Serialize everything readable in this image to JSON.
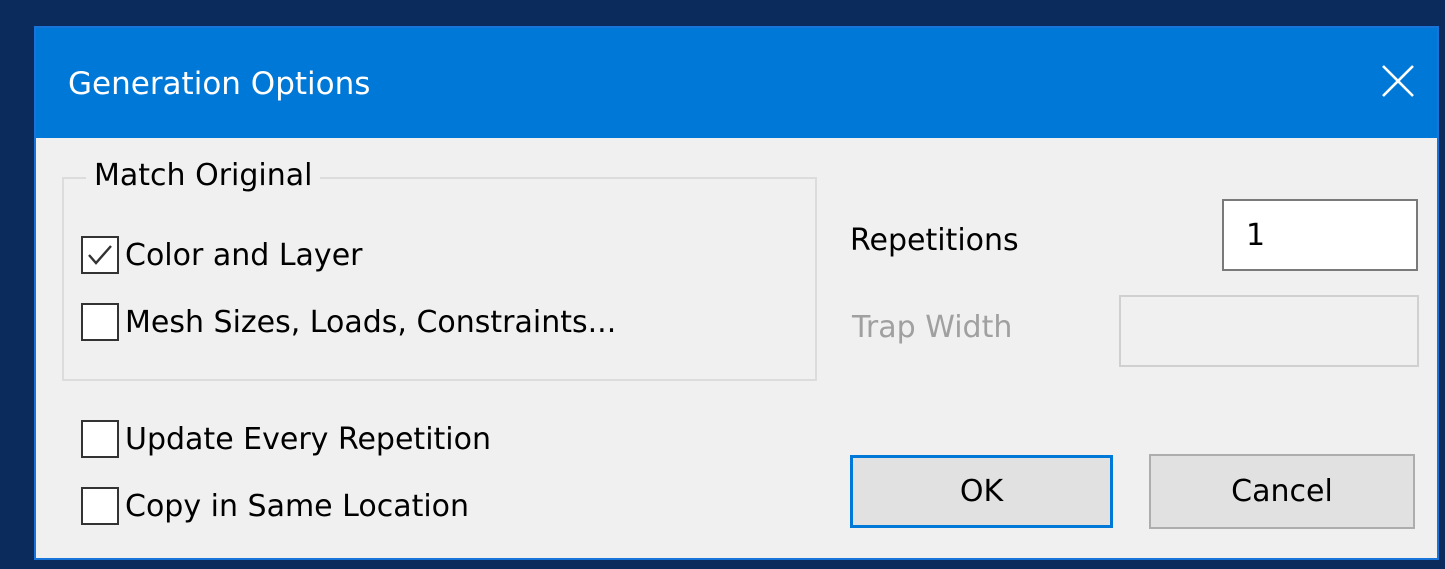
{
  "dialog": {
    "title": "Generation Options",
    "close_icon": "close-icon"
  },
  "match_original": {
    "legend": "Match Original",
    "color_and_layer": {
      "label": "Color and Layer",
      "checked": true
    },
    "mesh_sizes": {
      "label": "Mesh Sizes, Loads, Constraints...",
      "checked": false
    }
  },
  "options": {
    "update_every_repetition": {
      "label": "Update Every Repetition",
      "checked": false
    },
    "copy_in_same_location": {
      "label": "Copy in Same Location",
      "checked": false
    }
  },
  "repetitions": {
    "label": "Repetitions",
    "value": "1"
  },
  "trap_width": {
    "label": "Trap Width",
    "value": "",
    "enabled": false
  },
  "buttons": {
    "ok": "OK",
    "cancel": "Cancel"
  },
  "colors": {
    "title_bar": "#0078d7",
    "dialog_bg": "#f0f0f0",
    "disabled_text": "#a0a0a0",
    "default_button_border": "#0078d7"
  }
}
